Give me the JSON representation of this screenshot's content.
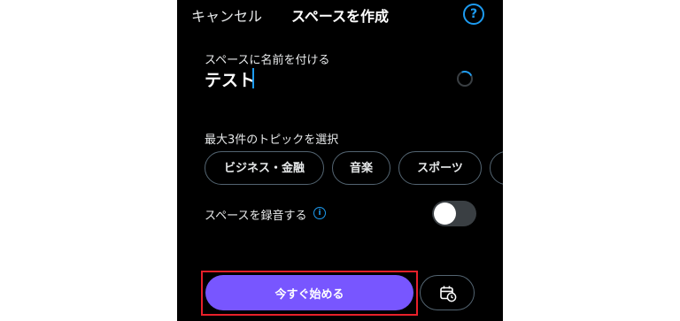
{
  "header": {
    "cancel_label": "キャンセル",
    "title": "スペースを作成",
    "help_symbol": "?"
  },
  "name_section": {
    "label": "スペースに名前を付ける",
    "value": "テスト"
  },
  "topics_section": {
    "label": "最大3件のトピックを選択",
    "topics": [
      "ビジネス・金融",
      "音楽",
      "スポーツ"
    ]
  },
  "record_section": {
    "label": "スペースを録音する",
    "info_symbol": "i",
    "recording_enabled": false
  },
  "actions": {
    "start_label": "今すぐ始める",
    "schedule_icon": "calendar-clock-icon"
  },
  "colors": {
    "accent": "#1d9bf0",
    "start_button": "#7856ff",
    "highlight": "#e8202a",
    "background": "#000000"
  }
}
